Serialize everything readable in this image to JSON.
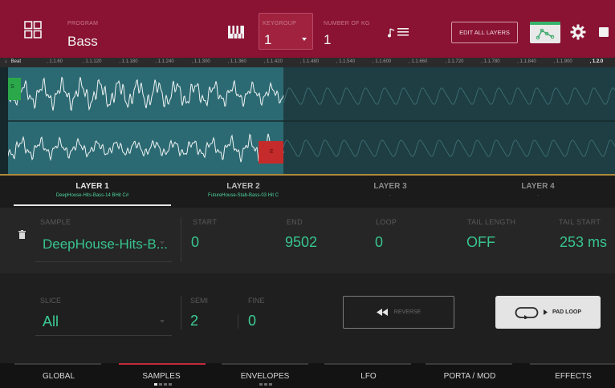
{
  "header": {
    "program_label": "PROGRAM",
    "program_value": "Bass",
    "keygroup_label": "KEYGROUP",
    "keygroup_value": "1",
    "number_of_kg_label": "NUMBER OF KG",
    "number_of_kg_value": "1",
    "edit_all_layers_label": "EDIT ALL LAYERS",
    "icons": [
      "grid-icon",
      "piano-icon",
      "note-list-icon",
      "envelope-icon",
      "gear-icon",
      "more-icon"
    ]
  },
  "ruler": {
    "beat_label": "Beat",
    "ticks": [
      "1.1.60",
      "1.1.120",
      "1.1.180",
      "1.1.240",
      "1.1.300",
      "1.1.360",
      "1.1.420",
      "1.1.480",
      "1.1.540",
      "1.1.600",
      "1.1.660",
      "1.1.720",
      "1.1.780",
      "1.1.840",
      "1.1.900",
      "1.2.0"
    ]
  },
  "waveform": {
    "start_marker": "S",
    "end_marker": "E"
  },
  "layers": [
    {
      "name": "LAYER 1",
      "sample": "DeepHouse-Hits-Bass-14 BHit C#"
    },
    {
      "name": "LAYER 2",
      "sample": "FutureHouse-Stab-Bass-03 Hit C"
    },
    {
      "name": "LAYER 3",
      "sample": "-"
    },
    {
      "name": "LAYER 4",
      "sample": "-"
    }
  ],
  "params": {
    "sample_label": "SAMPLE",
    "sample_value": "DeepHouse-Hits-B...",
    "start_label": "START",
    "start_value": "0",
    "end_label": "END",
    "end_value": "9502",
    "loop_label": "LOOP",
    "loop_value": "0",
    "tail_length_label": "TAIL LENGTH",
    "tail_length_value": "OFF",
    "tail_start_label": "TAIL START",
    "tail_start_value": "253 ms"
  },
  "lower": {
    "slice_label": "SLICE",
    "slice_value": "All",
    "semi_label": "SEMI",
    "semi_value": "2",
    "fine_label": "FINE",
    "fine_value": "0",
    "reverse_label": "REVERSE",
    "pad_loop_label": "PAD LOOP"
  },
  "bottom_tabs": [
    "GLOBAL",
    "SAMPLES",
    "ENVELOPES",
    "LFO",
    "PORTA / MOD",
    "EFFECTS"
  ],
  "colors": {
    "header_bg": "#8a1233",
    "value_green": "#37c58f",
    "waveform_selected": "#2c6a73",
    "start_marker": "#2ba84a",
    "end_marker": "#c62b2b",
    "samples_tab_accent": "#c22a3c"
  }
}
